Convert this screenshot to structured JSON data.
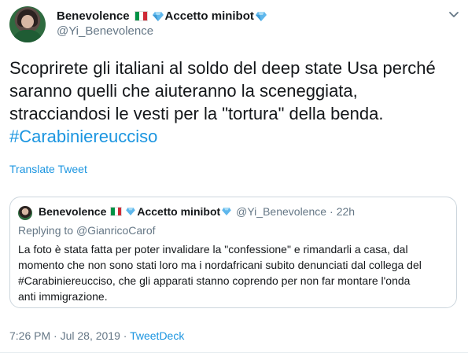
{
  "author": {
    "display_name": "Benevolence",
    "display_name_suffix": "Accetto minibot",
    "handle": "@Yi_Benevolence"
  },
  "icons": {
    "flag": "italy-flag-icon",
    "gem": "blue-diamond-icon",
    "caret": "chevron-down-icon"
  },
  "tweet": {
    "line1": "Scoprirete gli italiani al soldo del deep state Usa perché",
    "line2": "saranno quelli che aiuteranno la sceneggiata,",
    "line3": "stracciandosi le vesti per la \"tortura\" della benda.",
    "hashtag": "#Carabiniereucciso"
  },
  "translate_label": "Translate Tweet",
  "quoted": {
    "display_name": "Benevolence",
    "display_name_suffix": "Accetto minibot",
    "handle": "@Yi_Benevolence",
    "separator": "·",
    "age": "22h",
    "replying_prefix": "Replying to",
    "replying_to": "@GianricoCarof",
    "line1": "La foto è stata fatta per poter invalidare la \"confessione\" e rimandarli a casa, dal",
    "line2": "momento che non sono stati loro ma i nordafricani subito denunciati dal collega del",
    "line3": "#Carabiniereucciso, che gli apparati stanno coprendo per non far montare l'onda",
    "line4": "anti immigrazione."
  },
  "footer": {
    "time": "7:26 PM",
    "separator1": "·",
    "date": "Jul 28, 2019",
    "separator2": "·",
    "source": "TweetDeck"
  },
  "colors": {
    "link": "#1b95e0",
    "secondary": "#657786",
    "border": "#ccd6dd"
  }
}
